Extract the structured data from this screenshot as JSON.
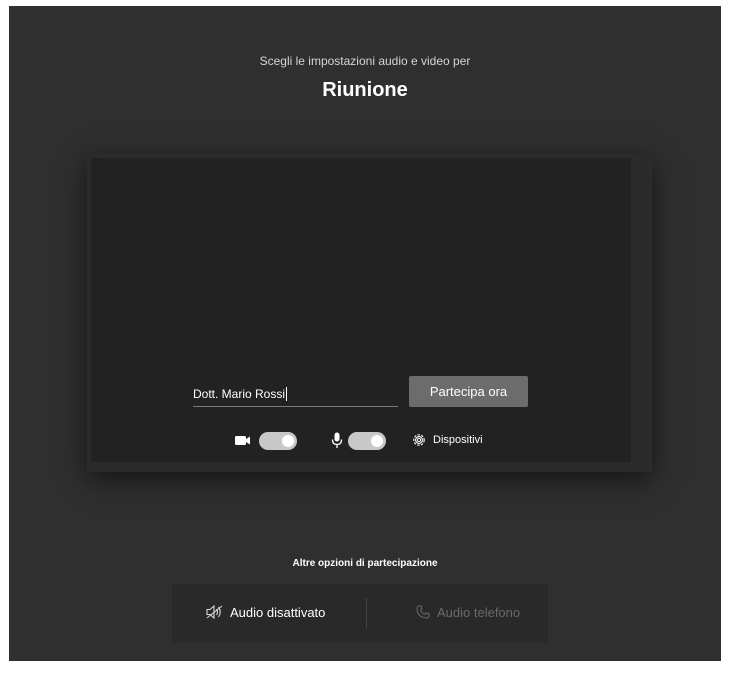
{
  "header": {
    "subtitle": "Scegli le impostazioni audio e video per",
    "title": "Riunione"
  },
  "prejoin": {
    "name_value": "Dott. Mario Rossi",
    "join_label": "Partecipa ora",
    "camera_on": true,
    "mic_on": true,
    "devices_label": "Dispositivi"
  },
  "other_options": {
    "title": "Altre opzioni di partecipazione",
    "audio_off_label": "Audio disattivato",
    "phone_audio_label": "Audio telefono"
  },
  "icons": {
    "camera": "camera-icon",
    "mic": "microphone-icon",
    "devices": "gear-icon",
    "speaker_off": "speaker-off-icon",
    "phone": "phone-icon"
  },
  "colors": {
    "background": "#2f2f2f",
    "preview": "#222222",
    "button": "#6c6c6c",
    "toggle": "#c8c8c8",
    "disabled_text": "#6a6a6a"
  }
}
